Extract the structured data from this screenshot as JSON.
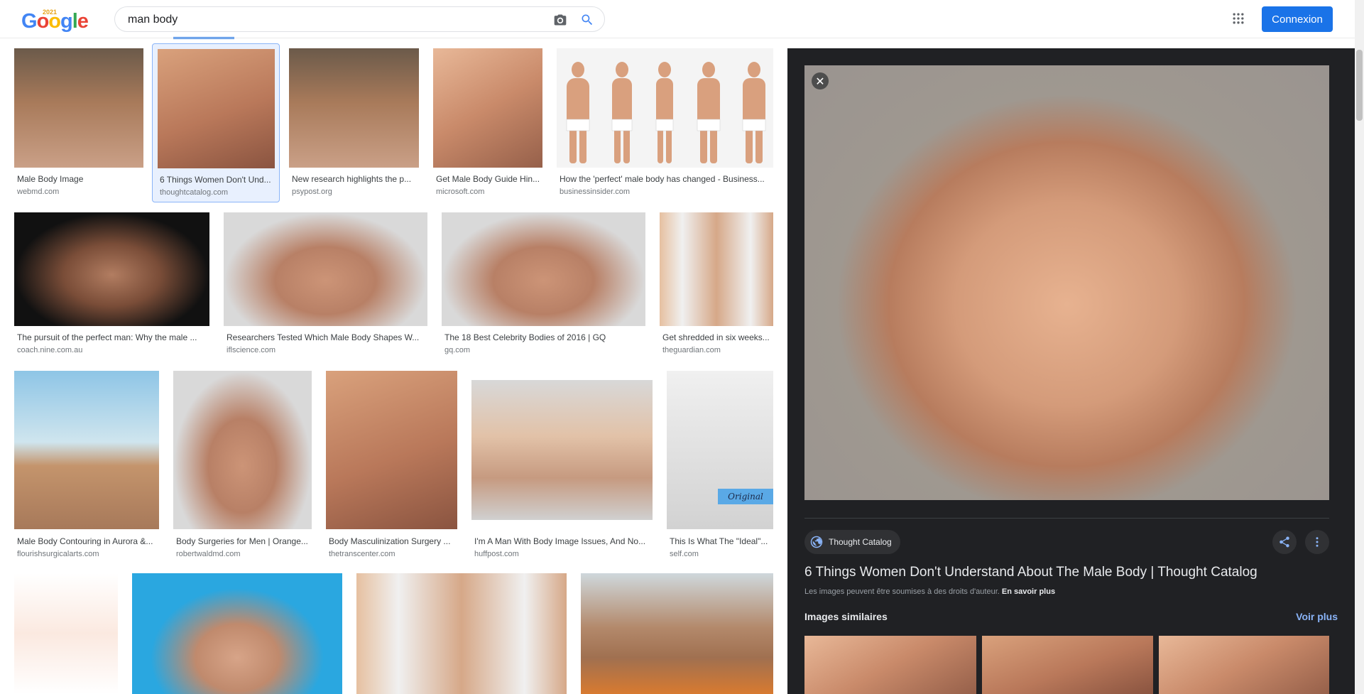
{
  "header": {
    "logo_letters": [
      "G",
      "o",
      "o",
      "g",
      "l",
      "e"
    ],
    "logo_year": "2021",
    "search_query": "man body",
    "signin_label": "Connexion"
  },
  "results": [
    {
      "caption": "Male Body Image",
      "source": "webmd.com"
    },
    {
      "caption": "6 Things Women Don't Und...",
      "source": "thoughtcatalog.com"
    },
    {
      "caption": "New research highlights the p...",
      "source": "psypost.org"
    },
    {
      "caption": "Get Male Body Guide Hin...",
      "source": "microsoft.com"
    },
    {
      "caption": "How the 'perfect' male body has changed - Business...",
      "source": "businessinsider.com"
    },
    {
      "caption": "The pursuit of the perfect man: Why the male ...",
      "source": "coach.nine.com.au"
    },
    {
      "caption": "Researchers Tested Which Male Body Shapes W...",
      "source": "iflscience.com"
    },
    {
      "caption": "The 18 Best Celebrity Bodies of 2016 | GQ",
      "source": "gq.com"
    },
    {
      "caption": "Get shredded in six weeks...",
      "source": "theguardian.com"
    },
    {
      "caption": "Male Body Contouring in Aurora &...",
      "source": "flourishsurgicalarts.com"
    },
    {
      "caption": "Body Surgeries for Men | Orange...",
      "source": "robertwaldmd.com"
    },
    {
      "caption": "Body Masculinization Surgery ...",
      "source": "thetranscenter.com"
    },
    {
      "caption": "I'm A Man With Body Image Issues, And No...",
      "source": "huffpost.com"
    },
    {
      "caption": "This Is What The \"Ideal\"...",
      "source": "self.com"
    }
  ],
  "overlay_text": {
    "original": "Original"
  },
  "panel": {
    "source_name": "Thought Catalog",
    "title": "6 Things Women Don't Understand About The Male Body | Thought Catalog",
    "rights_text": "Les images peuvent être soumises à des droits d'auteur.",
    "rights_link": "En savoir plus",
    "similar_label": "Images similaires",
    "voir_plus": "Voir plus",
    "close_glyph": "✕"
  },
  "colors": {
    "accent": "#1a73e8",
    "panel_bg": "#202124",
    "link": "#8ab4f8"
  }
}
